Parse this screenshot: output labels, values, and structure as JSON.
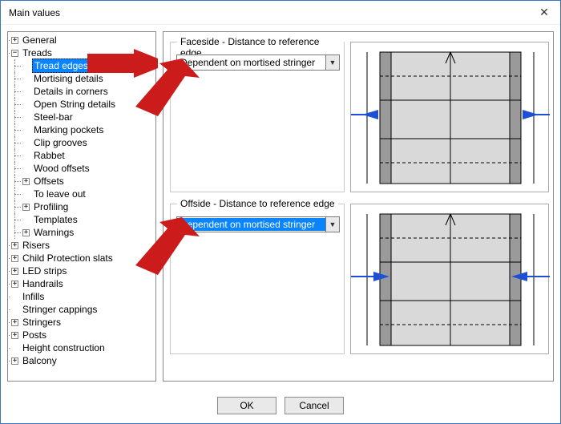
{
  "window": {
    "title": "Main values"
  },
  "tree": {
    "general": "General",
    "treads": "Treads",
    "tread_edges": "Tread edges",
    "mortising_details": "Mortising details",
    "details_in_corners": "Details in corners",
    "open_string_details": "Open String details",
    "steel_bar": "Steel-bar",
    "marking_pockets": "Marking pockets",
    "clip_grooves": "Clip grooves",
    "rabbet": "Rabbet",
    "wood_offsets": "Wood offsets",
    "offsets": "Offsets",
    "to_leave_out": "To leave out",
    "profiling": "Profiling",
    "templates": "Templates",
    "warnings": "Warnings",
    "risers": "Risers",
    "child_protection_slats": "Child Protection slats",
    "led_strips": "LED strips",
    "handrails": "Handrails",
    "infills": "Infills",
    "stringer_cappings": "Stringer cappings",
    "stringers": "Stringers",
    "posts": "Posts",
    "height_construction": "Height construction",
    "balcony": "Balcony"
  },
  "panel": {
    "faceside_group": "Faceside - Distance to reference edge",
    "offside_group": "Offside - Distance to reference edge",
    "faceside_value": "Dependent on mortised stringer",
    "offside_value": "Dependent on mortised stringer"
  },
  "buttons": {
    "ok": "OK",
    "cancel": "Cancel"
  },
  "glyph": {
    "plus": "+",
    "minus": "−",
    "close": "✕",
    "down": "▼"
  }
}
